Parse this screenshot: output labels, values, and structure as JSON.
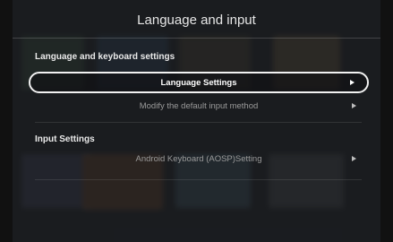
{
  "window": {
    "title": "Language and input"
  },
  "sections": [
    {
      "header": "Language and keyboard settings",
      "items": [
        {
          "label": "Language Settings",
          "icon": "chevron-right-icon",
          "selected": true
        },
        {
          "label": "Modify the default input method",
          "icon": "chevron-right-icon",
          "selected": false
        }
      ]
    },
    {
      "header": "Input Settings",
      "items": [
        {
          "label": "Android Keyboard (AOSP)Setting",
          "icon": "chevron-right-icon",
          "selected": false
        }
      ]
    }
  ],
  "colors": {
    "focus_border": "#f2f2f2",
    "overlay": "#1c1e22"
  }
}
